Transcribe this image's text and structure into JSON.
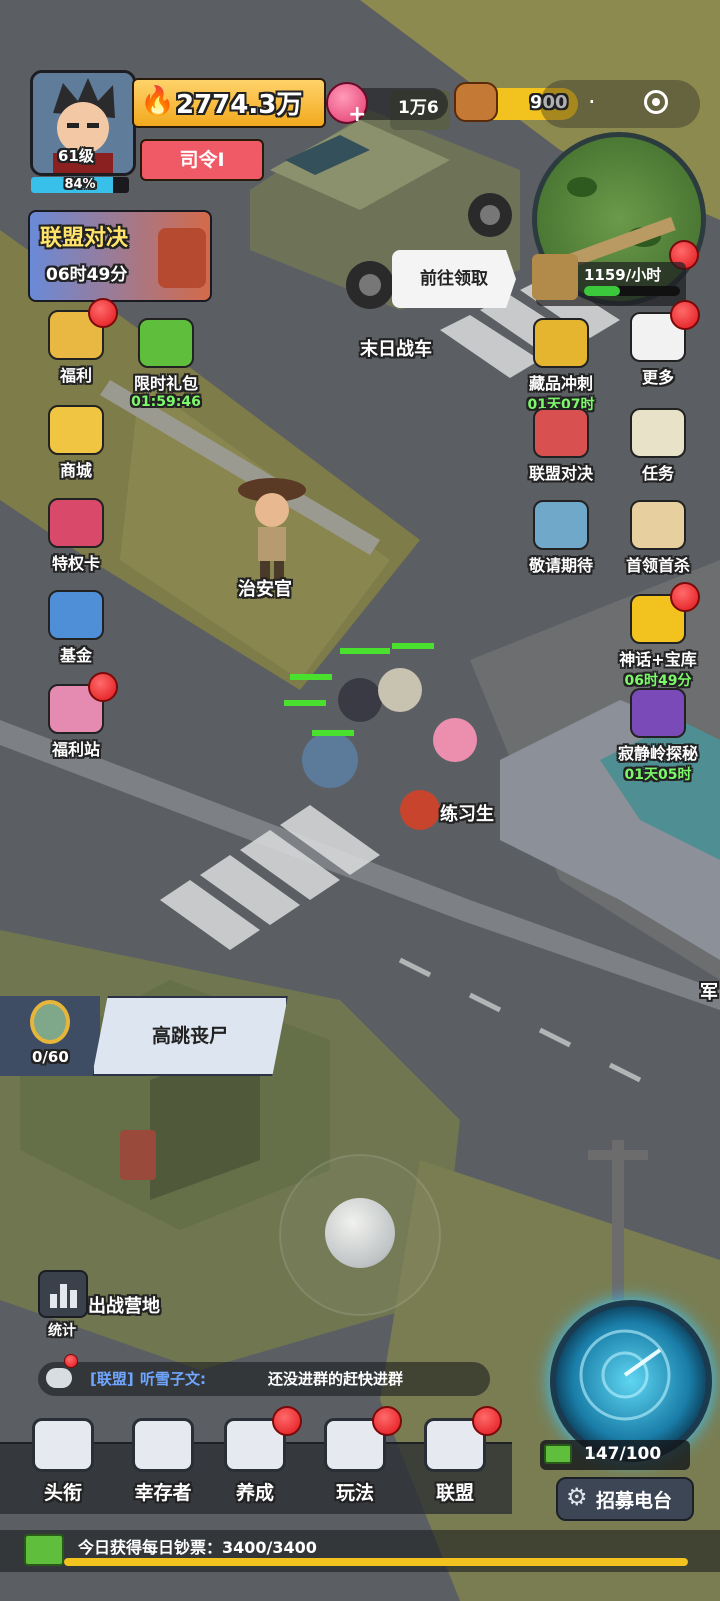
{
  "player": {
    "level": "61级",
    "exp_percent": "84%",
    "exp_fraction": 0.84,
    "power": "2774.3万",
    "rank_title": "司令Ⅰ"
  },
  "currencies": {
    "gems": "1万6",
    "wood": "900"
  },
  "event_banner": {
    "title": "联盟对决",
    "timer": "06时49分"
  },
  "production": {
    "rate": "1159/小时",
    "collect_tip": "前往领取"
  },
  "left_menu": [
    {
      "label": "福利",
      "timer": "",
      "icon": "gift-basket-icon",
      "badge": true
    },
    {
      "label": "限时礼包",
      "timer": "01:59:46",
      "icon": "cash-clock-icon",
      "badge": false
    },
    {
      "label": "商城",
      "timer": "",
      "icon": "shop-basket-icon",
      "badge": false
    },
    {
      "label": "特权卡",
      "timer": "",
      "icon": "privilege-card-icon",
      "badge": false
    },
    {
      "label": "基金",
      "timer": "",
      "icon": "fund-book-icon",
      "badge": false
    },
    {
      "label": "福利站",
      "timer": "",
      "icon": "welfare-station-icon",
      "badge": true
    }
  ],
  "right_menu": [
    {
      "label": "藏品冲刺",
      "timer": "01天07时",
      "icon": "collection-trophy-icon",
      "badge": false
    },
    {
      "label": "更多",
      "timer": "",
      "icon": "more-grid-icon",
      "badge": true
    },
    {
      "label": "联盟对决",
      "timer": "",
      "icon": "crossed-swords-icon",
      "badge": false
    },
    {
      "label": "任务",
      "timer": "",
      "icon": "task-clipboard-icon",
      "badge": false
    },
    {
      "label": "敬请期待",
      "timer": "",
      "icon": "robot-icon",
      "badge": false
    },
    {
      "label": "首领首杀",
      "timer": "",
      "icon": "wanted-poster-icon",
      "badge": false
    },
    {
      "label": "神话+宝库",
      "timer": "06时49分",
      "icon": "mystery-box-icon",
      "badge": true
    },
    {
      "label": "寂静岭探秘",
      "timer": "01天05时",
      "icon": "haunted-house-icon",
      "badge": false
    }
  ],
  "map_labels": {
    "war_vehicle": "末日战车",
    "sheriff": "治安官",
    "trainee": "练习生",
    "camp": "出战营地",
    "military": "军"
  },
  "zombie_task": {
    "name": "高跳丧尸",
    "progress": "0/60"
  },
  "stats_button": "统计",
  "chat": {
    "channel": "[联盟]",
    "sender": "听雪子文:",
    "message": "还没进群的赶快进群"
  },
  "bottom_nav": [
    {
      "label": "头衔",
      "icon": "rank-star-icon",
      "badge": false
    },
    {
      "label": "幸存者",
      "icon": "cowboy-hat-icon",
      "badge": false
    },
    {
      "label": "养成",
      "icon": "grid-icon",
      "badge": true
    },
    {
      "label": "玩法",
      "icon": "open-book-icon",
      "badge": true
    },
    {
      "label": "联盟",
      "icon": "shield-icon",
      "badge": true
    }
  ],
  "recruit": {
    "count": "147/100",
    "button": "招募电台"
  },
  "daily_cash": {
    "text": "今日获得每日钞票：3400/3400",
    "fraction": 1.0
  },
  "colors": {
    "power_bg": "#f5b731",
    "rank_bg": "#ef5a66",
    "timer_green": "#7cf86a",
    "badge_red": "#e0151b",
    "road": "#5b5f63",
    "grass": "#8c8a4e"
  }
}
